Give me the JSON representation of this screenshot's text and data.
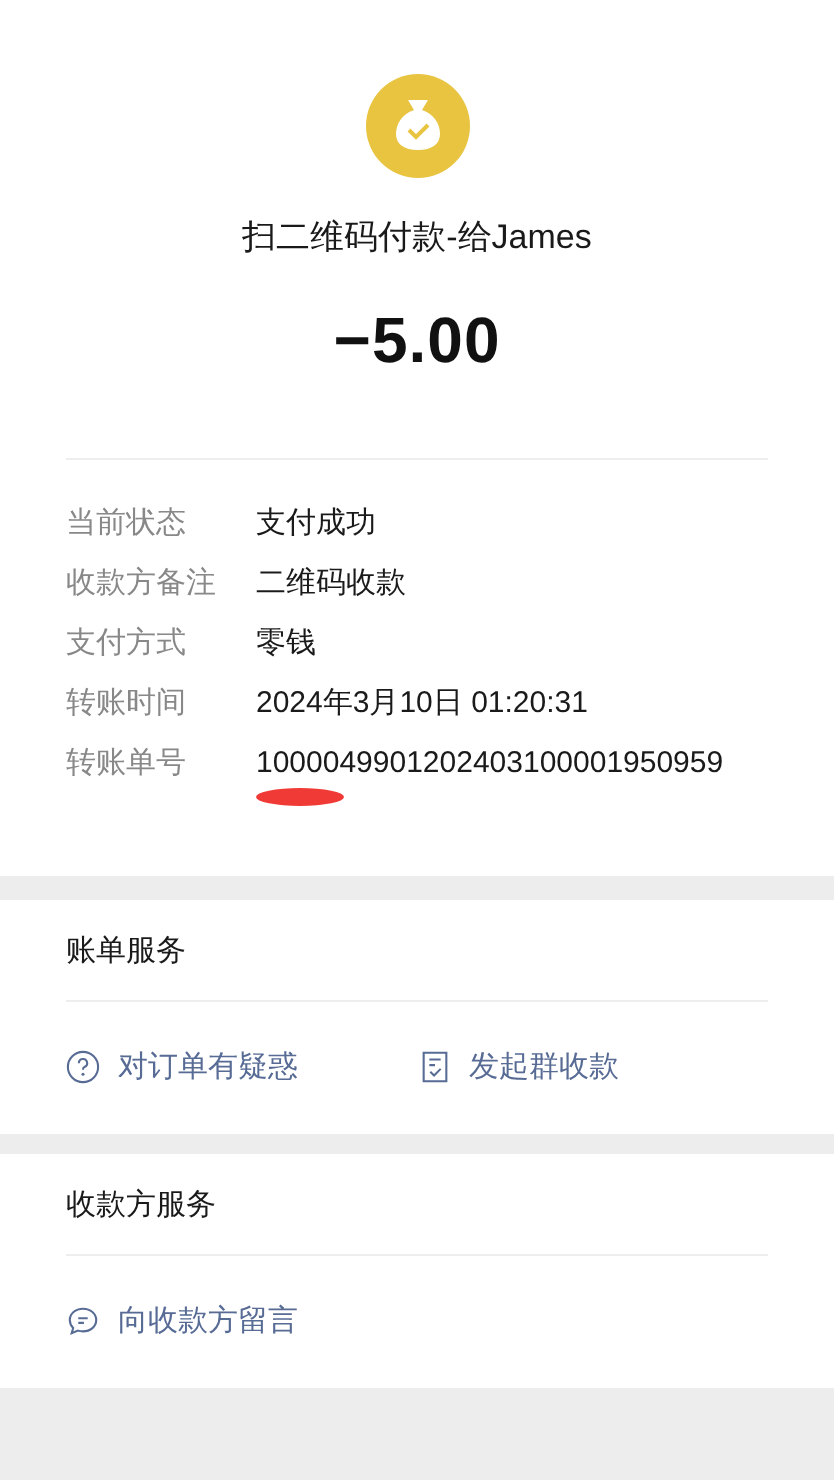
{
  "header": {
    "title": "扫二维码付款-给James",
    "amount": "−5.00"
  },
  "details": [
    {
      "label": "当前状态",
      "value": "支付成功",
      "redacted": false
    },
    {
      "label": "收款方备注",
      "value": "二维码收款",
      "redacted": false
    },
    {
      "label": "支付方式",
      "value": "零钱",
      "redacted": false
    },
    {
      "label": "转账时间",
      "value": "2024年3月10日 01:20:31",
      "redacted": false
    },
    {
      "label": "转账单号",
      "value": "1000049901202403100001950959",
      "redacted": true
    }
  ],
  "sections": [
    {
      "title": "账单服务",
      "actions": [
        {
          "kind": "question",
          "label": "对订单有疑惑"
        },
        {
          "kind": "bill",
          "label": "发起群收款"
        }
      ]
    },
    {
      "title": "收款方服务",
      "actions": [
        {
          "kind": "message",
          "label": "向收款方留言"
        }
      ]
    }
  ]
}
